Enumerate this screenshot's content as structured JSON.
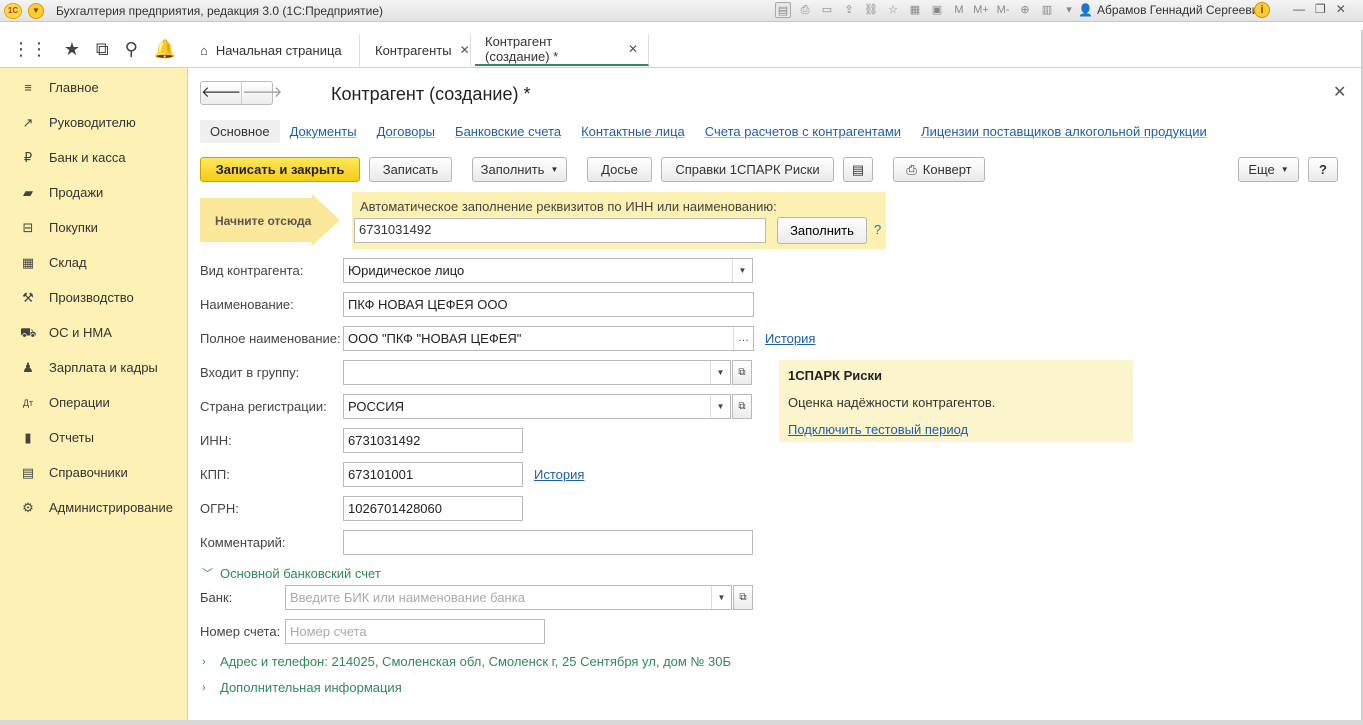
{
  "window": {
    "app_title": "Бухгалтерия предприятия, редакция 3.0  (1С:Предприятие)",
    "logo_text": "1С",
    "user": "Абрамов Геннадий Сергеевич",
    "tool_labels": [
      "M",
      "M+",
      "M-"
    ]
  },
  "tabs": [
    {
      "label": "Начальная страница"
    },
    {
      "label": "Контрагенты"
    },
    {
      "label": "Контрагент (создание) *"
    }
  ],
  "sidebar": {
    "items": [
      {
        "label": "Главное",
        "icon": "menu-icon"
      },
      {
        "label": "Руководителю",
        "icon": "trend-icon"
      },
      {
        "label": "Банк и касса",
        "icon": "ruble-icon"
      },
      {
        "label": "Продажи",
        "icon": "cart-icon"
      },
      {
        "label": "Покупки",
        "icon": "basket-icon"
      },
      {
        "label": "Склад",
        "icon": "warehouse-icon"
      },
      {
        "label": "Производство",
        "icon": "production-icon"
      },
      {
        "label": "ОС и НМА",
        "icon": "truck-icon"
      },
      {
        "label": "Зарплата и кадры",
        "icon": "person-icon"
      },
      {
        "label": "Операции",
        "icon": "dtkt-icon"
      },
      {
        "label": "Отчеты",
        "icon": "bar-chart-icon"
      },
      {
        "label": "Справочники",
        "icon": "book-icon"
      },
      {
        "label": "Администрирование",
        "icon": "gear-icon"
      }
    ]
  },
  "form": {
    "title": "Контрагент (создание) *",
    "subtabs": [
      "Основное",
      "Документы",
      "Договоры",
      "Банковские счета",
      "Контактные лица",
      "Счета расчетов с контрагентами",
      "Лицензии поставщиков алкогольной продукции"
    ],
    "buttons": {
      "save_close": "Записать и закрыть",
      "save": "Записать",
      "fill": "Заполнить",
      "dossier": "Досье",
      "spark_refs": "Справки 1СПАРК Риски",
      "envelope": "Конверт",
      "more": "Еще",
      "help": "?"
    },
    "start_here": "Начните отсюда",
    "autofill": {
      "label": "Автоматическое заполнение реквизитов по ИНН или наименованию:",
      "value": "6731031492",
      "button": "Заполнить",
      "help": "?"
    },
    "fields": {
      "kind": {
        "label": "Вид контрагента:",
        "value": "Юридическое лицо"
      },
      "name": {
        "label": "Наименование:",
        "value": "ПКФ НОВАЯ ЦЕФЕЯ ООО"
      },
      "full_name": {
        "label": "Полное наименование:",
        "value": "ООО \"ПКФ \"НОВАЯ ЦЕФЕЯ\"",
        "link": "История"
      },
      "group": {
        "label": "Входит в группу:",
        "value": ""
      },
      "country": {
        "label": "Страна регистрации:",
        "value": "РОССИЯ"
      },
      "inn": {
        "label": "ИНН:",
        "value": "6731031492"
      },
      "kpp": {
        "label": "КПП:",
        "value": "673101001",
        "link": "История"
      },
      "ogrn": {
        "label": "ОГРН:",
        "value": "1026701428060"
      },
      "comment": {
        "label": "Комментарий:",
        "value": ""
      }
    },
    "bank_group": {
      "title": "Основной банковский счет",
      "bank_label": "Банк:",
      "bank_placeholder": "Введите БИК или наименование банка",
      "account_label": "Номер счета:",
      "account_placeholder": "Номер счета"
    },
    "address_group": "Адрес и телефон: 214025, Смоленская обл, Смоленск г, 25 Сентября ул, дом № 30Б",
    "extra_group": "Дополнительная информация",
    "spark": {
      "title": "1СПАРК Риски",
      "description": "Оценка надёжности контрагентов.",
      "link": "Подключить тестовый период"
    }
  },
  "colors": {
    "sidebar_bg": "#fdf1b5",
    "primary_button": "#f6cc16",
    "link": "#1c5fa8",
    "group_green": "#2e8b57"
  }
}
